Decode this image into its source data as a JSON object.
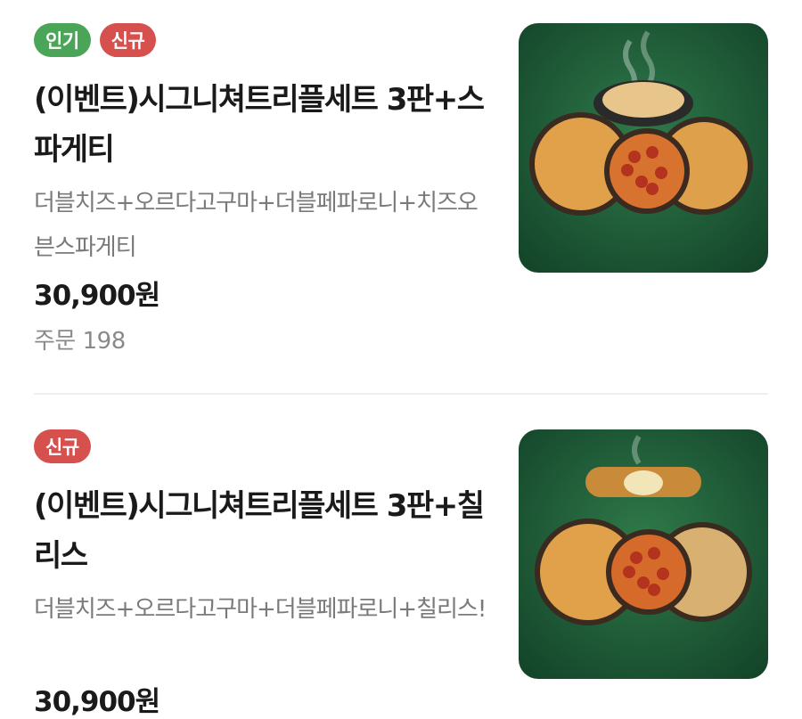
{
  "items": [
    {
      "badges": [
        "인기",
        "신규"
      ],
      "title": "(이벤트)시그니쳐트리플세트 3판+스파게티",
      "description": "더블치즈+오르다고구마+더블페파로니+치즈오븐스파게티",
      "price": "30,900원",
      "orders": "주문 198",
      "image": "pizza-set-with-spaghetti"
    },
    {
      "badges": [
        "신규"
      ],
      "title": "(이벤트)시그니쳐트리플세트 3판+칠리스",
      "description": "더블치즈+오르다고구마+더블페파로니+칠리스!",
      "price": "30,900원",
      "image": "pizza-set-with-chilis"
    }
  ],
  "colors": {
    "popular_badge": "#4aa558",
    "new_badge": "#d6514d",
    "thumbnail_bg": "#1f5a35"
  }
}
